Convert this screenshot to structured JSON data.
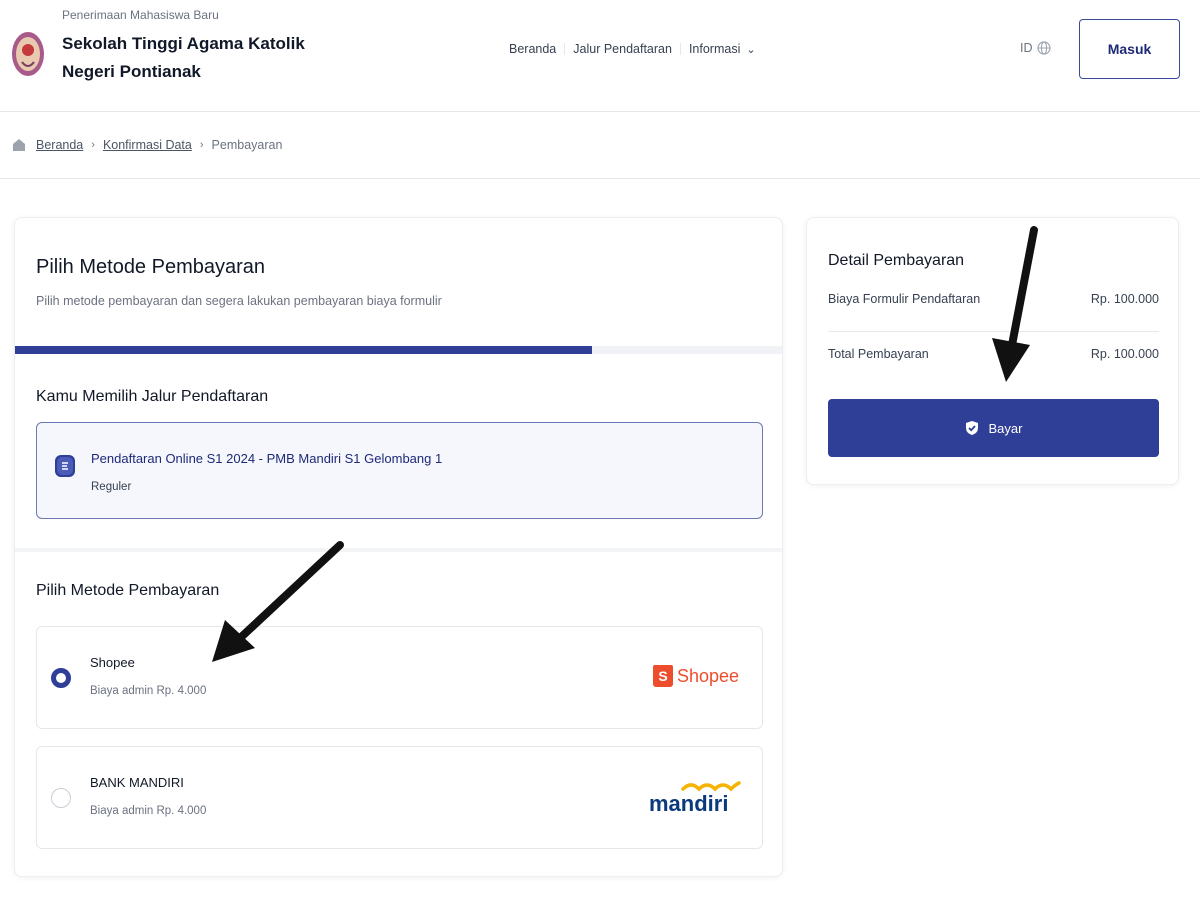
{
  "header": {
    "subtitle": "Penerimaan Mahasiswa Baru",
    "title": "Sekolah Tinggi Agama Katolik Negeri Pontianak",
    "nav": [
      {
        "label": "Beranda"
      },
      {
        "label": "Jalur Pendaftaran"
      },
      {
        "label": "Informasi"
      }
    ],
    "language": "ID",
    "login_label": "Masuk"
  },
  "breadcrumb": {
    "items": [
      "Beranda",
      "Konfirmasi Data",
      "Pembayaran"
    ]
  },
  "payment_method_card": {
    "title": "Pilih Metode Pembayaran",
    "subtitle": "Pilih metode pembayaran dan segera lakukan pembayaran biaya formulir",
    "progress": 0.75,
    "route_section_title": "Kamu Memilih Jalur Pendaftaran",
    "route": {
      "title": "Pendaftaran Online S1 2024 - PMB Mandiri S1 Gelombang 1",
      "type": "Reguler"
    },
    "methods_section_title": "Pilih Metode Pembayaran",
    "methods": [
      {
        "name": "Shopee",
        "fee": "Biaya admin Rp. 4.000",
        "selected": true,
        "logo_text": "Shopee",
        "logo_icon": "shopee-bag-icon"
      },
      {
        "name": "BANK MANDIRI",
        "fee": "Biaya admin Rp. 4.000",
        "selected": false,
        "logo_text": "mandiri",
        "logo_icon": "mandiri-wave-icon"
      }
    ]
  },
  "payment_detail": {
    "title": "Detail Pembayaran",
    "rows": [
      {
        "label": "Biaya Formulir Pendaftaran",
        "value": "Rp. 100.000"
      },
      {
        "label": "Total Pembayaran",
        "value": "Rp. 100.000"
      }
    ],
    "pay_label": "Bayar"
  },
  "colors": {
    "primary": "#2f3e97",
    "shopee": "#ee4d2d",
    "mandiri_blue": "#0a3a7d",
    "mandiri_gold": "#f5b400"
  }
}
